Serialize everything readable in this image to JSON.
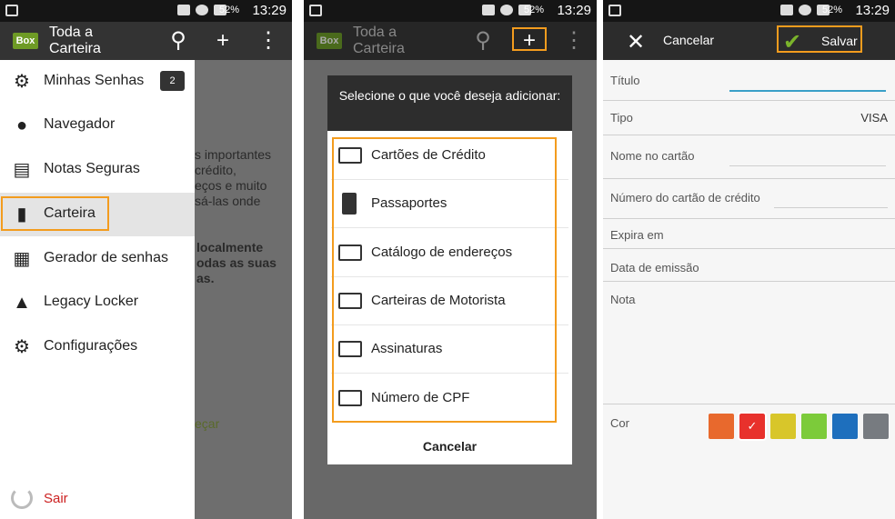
{
  "status_bar": {
    "battery": "52%",
    "time": "13:29"
  },
  "app": {
    "logo_text": "Box",
    "title": "Toda a Carteira"
  },
  "drawer": {
    "items": [
      {
        "label": "Minhas Senhas",
        "badge": "2"
      },
      {
        "label": "Navegador"
      },
      {
        "label": "Notas Seguras"
      },
      {
        "label": "Carteira"
      },
      {
        "label": "Gerador de senhas"
      },
      {
        "label": "Legacy Locker"
      },
      {
        "label": "Configurações"
      }
    ],
    "logout_label": "Sair"
  },
  "background_text": {
    "para1": [
      "s importantes",
      "crédito,",
      "eços e muito",
      "sá-las onde"
    ],
    "para2": [
      "localmente",
      "odas as suas",
      "as."
    ],
    "link": "eçar"
  },
  "dialog": {
    "heading": "Selecione o que você deseja adicionar:",
    "options": [
      "Cartões de Crédito",
      "Passaportes",
      "Catálogo de endereços",
      "Carteiras de Motorista",
      "Assinaturas",
      "Número de CPF"
    ],
    "cancel_label": "Cancelar"
  },
  "form": {
    "cancel_label": "Cancelar",
    "save_label": "Salvar",
    "fields": {
      "title": "Título",
      "type": "Tipo",
      "type_value": "VISA",
      "name_on_card": "Nome no cartão",
      "card_number": "Número do cartão de crédito",
      "expires": "Expira em",
      "issue_date": "Data de emissão",
      "note": "Nota",
      "color": "Cor"
    },
    "colors": [
      "#e8692d",
      "#e8312c",
      "#d8c62a",
      "#7ccb3a",
      "#1e6fbd",
      "#777b80"
    ],
    "selected_color_index": 1
  },
  "highlight_color": "#f39c1e"
}
